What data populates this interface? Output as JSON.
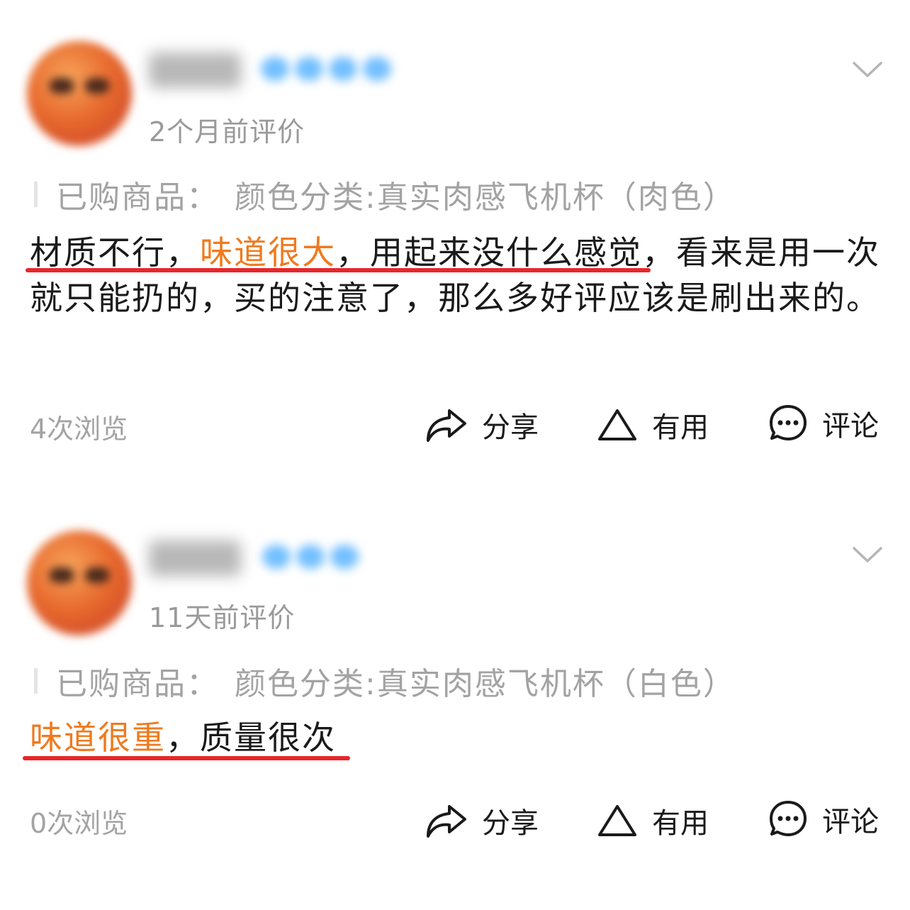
{
  "reviews": [
    {
      "time": "2个月前评价",
      "purchased_prefix": "已购商品：",
      "purchased_item": "颜色分类:真实肉感飞机杯（肉色）",
      "text_1": "材质不行，",
      "text_highlight": "味道很大",
      "text_2": "，用起来没什么感觉，看来是用一次就只能扔的，买的注意了，那么多好评应该是刷出来的。",
      "views": "4次浏览",
      "share": "分享",
      "useful": "有用",
      "comment": "评论"
    },
    {
      "time": "11天前评价",
      "purchased_prefix": "已购商品：",
      "purchased_item": "颜色分类:真实肉感飞机杯（白色）",
      "text_highlight": "味道很重",
      "text_2": "，质量很次",
      "views": "0次浏览",
      "share": "分享",
      "useful": "有用",
      "comment": "评论"
    }
  ],
  "colors": {
    "highlight": "#f07a1e",
    "underline": "#e8262a",
    "muted": "#9a9a9a",
    "badge": "#5ab4ff"
  },
  "icons": {
    "share": "share-arrow-icon",
    "useful": "triangle-up-icon",
    "comment": "speech-bubble-icon",
    "expand": "chevron-down-icon"
  }
}
